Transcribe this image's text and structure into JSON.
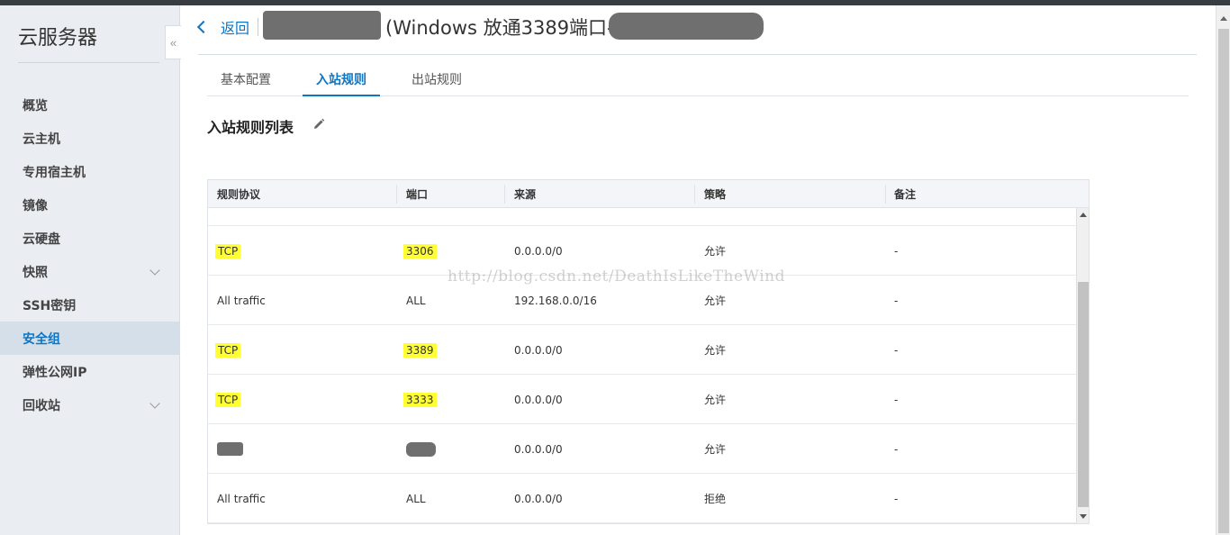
{
  "sidebar": {
    "title": "云服务器",
    "collapse_glyph": "«",
    "items": [
      {
        "label": "概览",
        "active": false,
        "expandable": false
      },
      {
        "label": "云主机",
        "active": false,
        "expandable": false
      },
      {
        "label": "专用宿主机",
        "active": false,
        "expandable": false
      },
      {
        "label": "镜像",
        "active": false,
        "expandable": false
      },
      {
        "label": "云硬盘",
        "active": false,
        "expandable": false
      },
      {
        "label": "快照",
        "active": false,
        "expandable": true
      },
      {
        "label": "SSH密钥",
        "active": false,
        "expandable": false
      },
      {
        "label": "安全组",
        "active": true,
        "expandable": false
      },
      {
        "label": "弹性公网IP",
        "active": false,
        "expandable": false
      },
      {
        "label": "回收站",
        "active": false,
        "expandable": true
      }
    ]
  },
  "header": {
    "back_label": "返回",
    "title": "(Windows 放通3389端口-"
  },
  "tabs": [
    {
      "label": "基本配置",
      "active": false
    },
    {
      "label": "入站规则",
      "active": true
    },
    {
      "label": "出站规则",
      "active": false
    }
  ],
  "section": {
    "title": "入站规则列表"
  },
  "table": {
    "columns": [
      "规则协议",
      "端口",
      "来源",
      "策略",
      "备注"
    ],
    "rows": [
      {
        "protocol": "TCP",
        "port": "3306",
        "source": "0.0.0.0/0",
        "policy": "允许",
        "note": "-",
        "highlight": true
      },
      {
        "protocol": "All traffic",
        "port": "ALL",
        "source": "192.168.0.0/16",
        "policy": "允许",
        "note": "-",
        "highlight": false
      },
      {
        "protocol": "TCP",
        "port": "3389",
        "source": "0.0.0.0/0",
        "policy": "允许",
        "note": "-",
        "highlight": true
      },
      {
        "protocol": "TCP",
        "port": "3333",
        "source": "0.0.0.0/0",
        "policy": "允许",
        "note": "-",
        "highlight": true
      },
      {
        "protocol": "",
        "port": "",
        "source": "0.0.0.0/0",
        "policy": "允许",
        "note": "-",
        "highlight": false,
        "redacted": true
      },
      {
        "protocol": "All traffic",
        "port": "ALL",
        "source": "0.0.0.0/0",
        "policy": "拒绝",
        "note": "-",
        "highlight": false
      }
    ]
  },
  "watermark": "http://blog.csdn.net/DeathIsLikeTheWind",
  "colors": {
    "accent": "#0d75c4",
    "highlight": "#ffff33",
    "sidebar_bg": "#eaedf1",
    "sidebar_active_bg": "#d4dfe9"
  }
}
